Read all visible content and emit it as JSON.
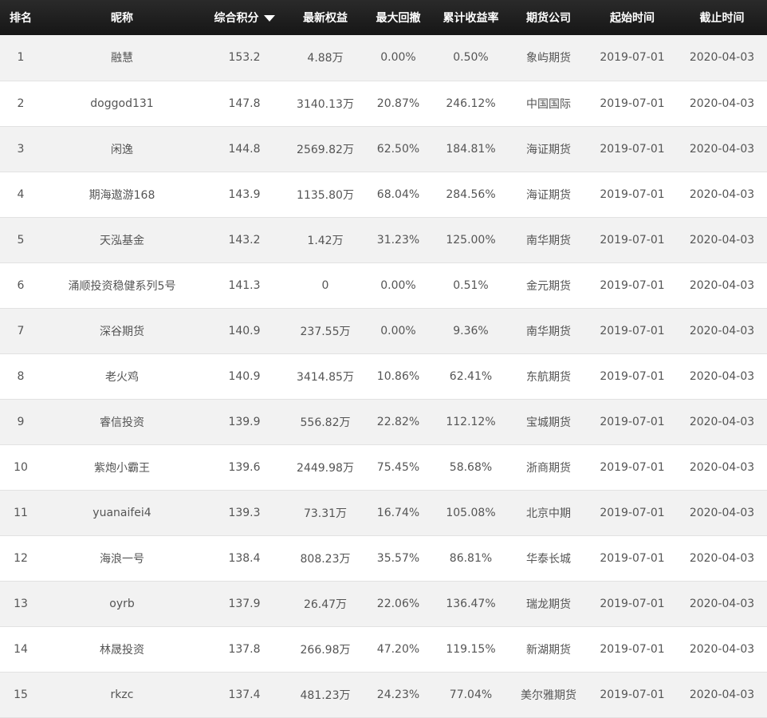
{
  "header": {
    "rank": "排名",
    "nickname": "昵称",
    "score": "综合积分",
    "equity": "最新权益",
    "drawdown": "最大回撤",
    "return": "累计收益率",
    "company": "期货公司",
    "start": "起始时间",
    "end": "截止时间"
  },
  "rows": [
    {
      "rank": "1",
      "nickname": "融慧",
      "score": "153.2",
      "equity": "4.88万",
      "drawdown": "0.00%",
      "return": "0.50%",
      "company": "象屿期货",
      "start": "2019-07-01",
      "end": "2020-04-03"
    },
    {
      "rank": "2",
      "nickname": "doggod131",
      "score": "147.8",
      "equity": "3140.13万",
      "drawdown": "20.87%",
      "return": "246.12%",
      "company": "中国国际",
      "start": "2019-07-01",
      "end": "2020-04-03"
    },
    {
      "rank": "3",
      "nickname": "闲逸",
      "score": "144.8",
      "equity": "2569.82万",
      "drawdown": "62.50%",
      "return": "184.81%",
      "company": "海证期货",
      "start": "2019-07-01",
      "end": "2020-04-03"
    },
    {
      "rank": "4",
      "nickname": "期海遨游168",
      "score": "143.9",
      "equity": "1135.80万",
      "drawdown": "68.04%",
      "return": "284.56%",
      "company": "海证期货",
      "start": "2019-07-01",
      "end": "2020-04-03"
    },
    {
      "rank": "5",
      "nickname": "天泓基金",
      "score": "143.2",
      "equity": "1.42万",
      "drawdown": "31.23%",
      "return": "125.00%",
      "company": "南华期货",
      "start": "2019-07-01",
      "end": "2020-04-03"
    },
    {
      "rank": "6",
      "nickname": "涌顺投资稳健系列5号",
      "score": "141.3",
      "equity": "0",
      "drawdown": "0.00%",
      "return": "0.51%",
      "company": "金元期货",
      "start": "2019-07-01",
      "end": "2020-04-03"
    },
    {
      "rank": "7",
      "nickname": "深谷期货",
      "score": "140.9",
      "equity": "237.55万",
      "drawdown": "0.00%",
      "return": "9.36%",
      "company": "南华期货",
      "start": "2019-07-01",
      "end": "2020-04-03"
    },
    {
      "rank": "8",
      "nickname": "老火鸡",
      "score": "140.9",
      "equity": "3414.85万",
      "drawdown": "10.86%",
      "return": "62.41%",
      "company": "东航期货",
      "start": "2019-07-01",
      "end": "2020-04-03"
    },
    {
      "rank": "9",
      "nickname": "睿信投资",
      "score": "139.9",
      "equity": "556.82万",
      "drawdown": "22.82%",
      "return": "112.12%",
      "company": "宝城期货",
      "start": "2019-07-01",
      "end": "2020-04-03"
    },
    {
      "rank": "10",
      "nickname": "紫炮小霸王",
      "score": "139.6",
      "equity": "2449.98万",
      "drawdown": "75.45%",
      "return": "58.68%",
      "company": "浙商期货",
      "start": "2019-07-01",
      "end": "2020-04-03"
    },
    {
      "rank": "11",
      "nickname": "yuanaifei4",
      "score": "139.3",
      "equity": "73.31万",
      "drawdown": "16.74%",
      "return": "105.08%",
      "company": "北京中期",
      "start": "2019-07-01",
      "end": "2020-04-03"
    },
    {
      "rank": "12",
      "nickname": "海浪一号",
      "score": "138.4",
      "equity": "808.23万",
      "drawdown": "35.57%",
      "return": "86.81%",
      "company": "华泰长城",
      "start": "2019-07-01",
      "end": "2020-04-03"
    },
    {
      "rank": "13",
      "nickname": "oyrb",
      "score": "137.9",
      "equity": "26.47万",
      "drawdown": "22.06%",
      "return": "136.47%",
      "company": "瑞龙期货",
      "start": "2019-07-01",
      "end": "2020-04-03"
    },
    {
      "rank": "14",
      "nickname": "林晟投资",
      "score": "137.8",
      "equity": "266.98万",
      "drawdown": "47.20%",
      "return": "119.15%",
      "company": "新湖期货",
      "start": "2019-07-01",
      "end": "2020-04-03"
    },
    {
      "rank": "15",
      "nickname": "rkzc",
      "score": "137.4",
      "equity": "481.23万",
      "drawdown": "24.23%",
      "return": "77.04%",
      "company": "美尔雅期货",
      "start": "2019-07-01",
      "end": "2020-04-03"
    }
  ]
}
